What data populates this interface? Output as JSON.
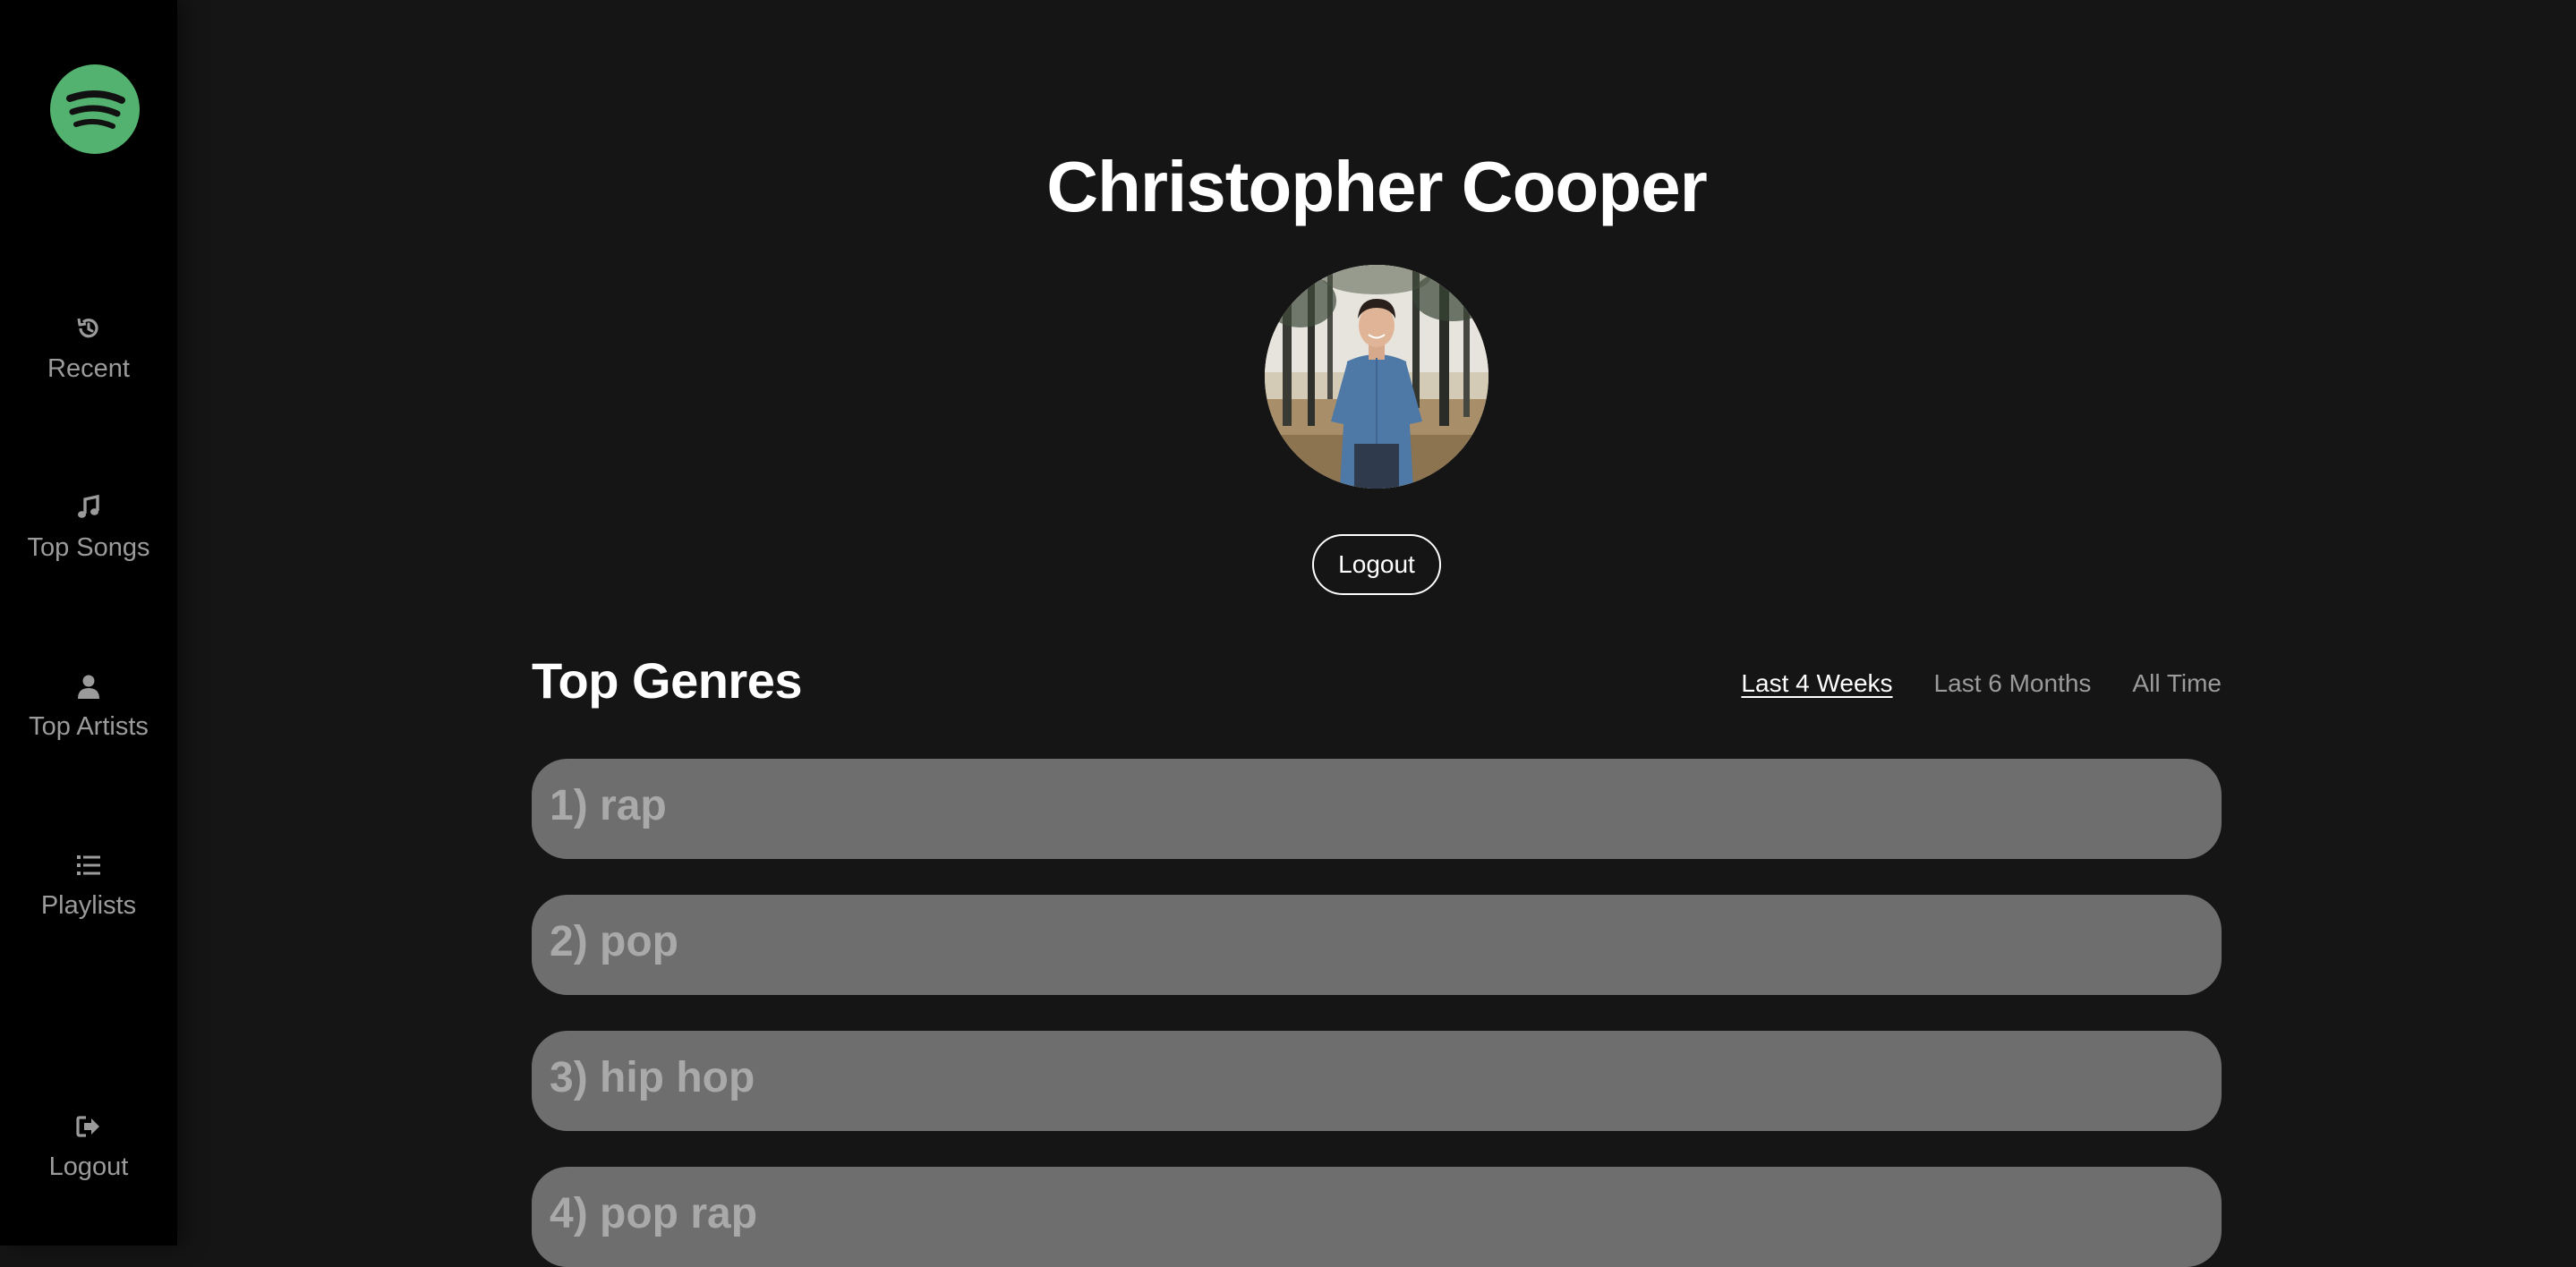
{
  "sidebar": {
    "logo_icon": "spotify-logo-icon",
    "brand_color": "#53b26f",
    "items": [
      {
        "label": "Recent",
        "icon": "history-icon"
      },
      {
        "label": "Top Songs",
        "icon": "music-note-icon"
      },
      {
        "label": "Top Artists",
        "icon": "user-icon"
      },
      {
        "label": "Playlists",
        "icon": "list-icon"
      }
    ],
    "logout": {
      "label": "Logout",
      "icon": "sign-out-icon"
    }
  },
  "profile": {
    "name": "Christopher Cooper",
    "logout_label": "Logout"
  },
  "genres": {
    "title": "Top Genres",
    "ranges": [
      {
        "label": "Last 4 Weeks",
        "active": true
      },
      {
        "label": "Last 6 Months",
        "active": false
      },
      {
        "label": "All Time",
        "active": false
      }
    ],
    "items": [
      {
        "label": "1) rap"
      },
      {
        "label": "2) pop"
      },
      {
        "label": "3) hip hop"
      },
      {
        "label": "4) pop rap"
      }
    ]
  }
}
